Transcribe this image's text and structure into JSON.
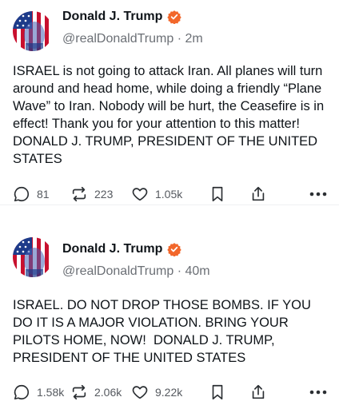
{
  "posts": [
    {
      "author": {
        "name": "Donald J. Trump",
        "handle": "@realDonaldTrump",
        "time": "2m"
      },
      "text": "ISRAEL is not going to attack Iran. All planes will turn around and head home, while doing a friendly “Plane Wave” to Iran. Nobody will be hurt, the Ceasefire is in effect! Thank you for your attention to this matter! DONALD J. TRUMP, PRESIDENT OF THE UNITED STATES",
      "stats": {
        "replies": "81",
        "reposts": "223",
        "likes": "1.05k"
      }
    },
    {
      "author": {
        "name": "Donald J. Trump",
        "handle": "@realDonaldTrump",
        "time": "40m"
      },
      "text": "ISRAEL. DO NOT DROP THOSE BOMBS. IF YOU DO IT IS A MAJOR VIOLATION. BRING YOUR PILOTS HOME, NOW!  DONALD J. TRUMP, PRESIDENT OF THE UNITED STATES",
      "stats": {
        "replies": "1.58k",
        "reposts": "2.06k",
        "likes": "9.22k"
      }
    }
  ],
  "separator": "·",
  "icons": {
    "avatar": "flag-portrait",
    "verified": "verified-badge-icon",
    "reply": "reply-icon",
    "repost": "repost-icon",
    "like": "heart-icon",
    "bookmark": "bookmark-icon",
    "share": "share-icon",
    "more": "more-icon"
  },
  "colors": {
    "verified": "#f2672b",
    "text": "#0f1419",
    "muted": "#6b6f75"
  }
}
